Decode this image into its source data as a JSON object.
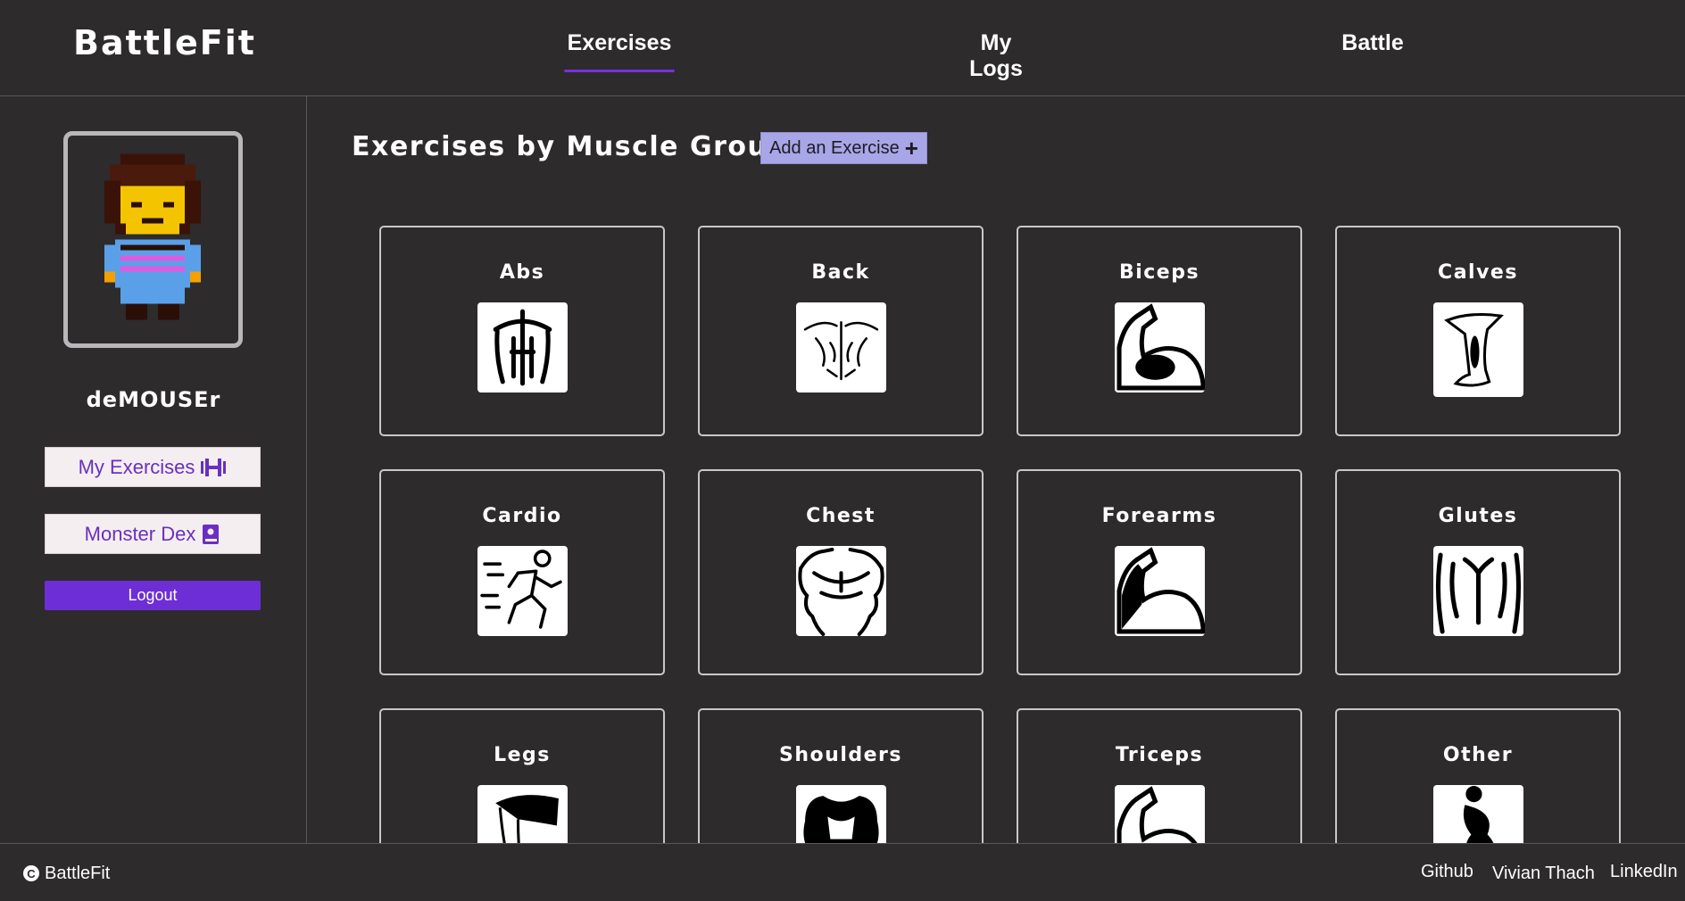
{
  "header": {
    "brand": "BattleFit",
    "nav": {
      "exercises": "Exercises",
      "logs": "My Logs",
      "battle": "Battle"
    }
  },
  "sidebar": {
    "username": "deMOUSEr",
    "my_exercises": "My Exercises",
    "monster_dex": "Monster Dex",
    "logout": "Logout"
  },
  "main": {
    "title": "Exercises by Muscle Group",
    "add_button": "Add an Exercise",
    "muscle_groups": [
      {
        "name": "Abs",
        "icon": "abs-icon"
      },
      {
        "name": "Back",
        "icon": "back-icon"
      },
      {
        "name": "Biceps",
        "icon": "biceps-icon"
      },
      {
        "name": "Calves",
        "icon": "calves-icon"
      },
      {
        "name": "Cardio",
        "icon": "cardio-icon"
      },
      {
        "name": "Chest",
        "icon": "chest-icon"
      },
      {
        "name": "Forearms",
        "icon": "forearms-icon"
      },
      {
        "name": "Glutes",
        "icon": "glutes-icon"
      },
      {
        "name": "Legs",
        "icon": "legs-icon"
      },
      {
        "name": "Shoulders",
        "icon": "shoulders-icon"
      },
      {
        "name": "Triceps",
        "icon": "triceps-icon"
      },
      {
        "name": "Other",
        "icon": "other-icon"
      }
    ]
  },
  "footer": {
    "brand": "BattleFit",
    "github": "Github",
    "author": "Vivian Thach",
    "linkedin": "LinkedIn"
  },
  "colors": {
    "background": "#2d2b2c",
    "accent": "#6e2ed6",
    "add_button": "#a8a6e6",
    "sidebar_button": "#f5eef0"
  }
}
